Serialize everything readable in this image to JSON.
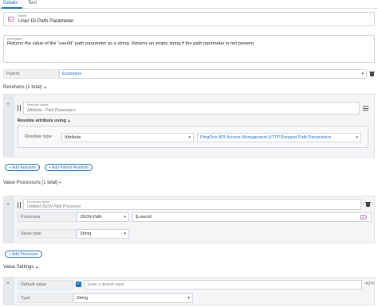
{
  "tabs": [
    {
      "label": "Details",
      "active": true
    },
    {
      "label": "Test",
      "active": false
    }
  ],
  "name_field": {
    "label": "Name",
    "value": "User ID Path Parameter"
  },
  "description_field": {
    "label": "Description",
    "value": "Returns the value of the \"userId\" path parameter as a string. Returns an empty string if the path parameter is not present."
  },
  "parent": {
    "label": "Parent",
    "value": "Examples"
  },
  "resolvers": {
    "title": "Resolvers (1 total)",
    "collapse_icon": "caret-up",
    "item": {
      "name_label": "Resolver Name",
      "name_placeholder": "Attribute - Path Parameters",
      "resolve_heading": "Resolve attribute using",
      "type_label": "Resolver type",
      "type_value": "Attribute",
      "attribute_value": "PingOne API Access Management.HTTP.Request.Path Parameters"
    },
    "add_resolver": "+ Add Resolver",
    "add_parent_resolver": "+ Add Parent Resolver"
  },
  "value_processors": {
    "title": "Value Processors (1 total)",
    "item": {
      "name_label": "Processor Name",
      "name_placeholder": "Untitled JSON Path Processor",
      "processor_label": "Processor",
      "processor_value": "JSON Path",
      "expression_value": "$.userId",
      "value_type_label": "Value type",
      "value_type_value": "String"
    },
    "add_processor": "+ Add Processor"
  },
  "value_settings": {
    "title": "Value Settings",
    "default_value_label": "Default value",
    "default_value_checked": true,
    "default_value_placeholder": "Enter a default value",
    "type_label": "Type",
    "type_value": "String"
  },
  "colors": {
    "accent": "#1a73c8",
    "tag": "#c06dbf"
  }
}
